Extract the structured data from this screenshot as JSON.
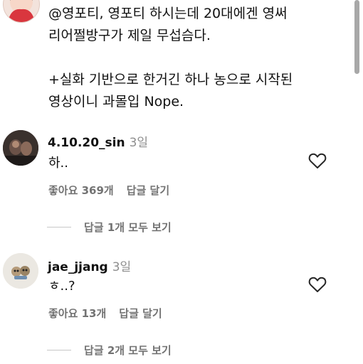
{
  "top_comment": {
    "lines": [
      "@영포티, 영포티 하시는데 20대에겐 영써",
      "리어쩔방구가 제일 무섭슴다.",
      "",
      "+실화 기반으로 한거긴 하나 농으로 시작된",
      "영상이니 과몰입 Nope."
    ]
  },
  "comments": [
    {
      "username": "4.10.20_sin",
      "time": "3일",
      "text": "하..",
      "likes": "좋아요 369개",
      "reply": "답글 달기",
      "view_replies": "답글 1개 모두 보기"
    },
    {
      "username": "jae_jjang",
      "time": "3일",
      "text": "ㅎ..?",
      "likes": "좋아요 13개",
      "reply": "답글 달기",
      "view_replies": "답글 2개 모두 보기"
    }
  ],
  "colors": {
    "secondary_text": "#737373",
    "timestamp": "#8e8e8e",
    "divider": "#c7c7c7"
  }
}
